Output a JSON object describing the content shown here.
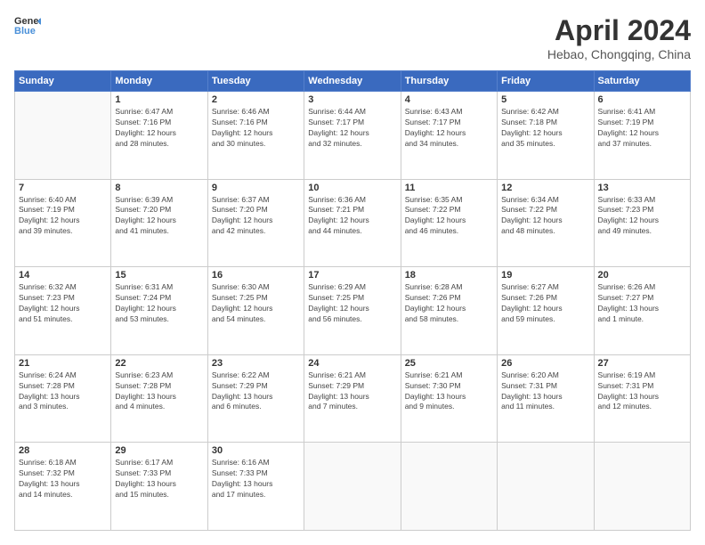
{
  "logo": {
    "line1": "General",
    "line2": "Blue"
  },
  "title": "April 2024",
  "subtitle": "Hebao, Chongqing, China",
  "days_header": [
    "Sunday",
    "Monday",
    "Tuesday",
    "Wednesday",
    "Thursday",
    "Friday",
    "Saturday"
  ],
  "weeks": [
    [
      {
        "num": "",
        "info": ""
      },
      {
        "num": "1",
        "info": "Sunrise: 6:47 AM\nSunset: 7:16 PM\nDaylight: 12 hours\nand 28 minutes."
      },
      {
        "num": "2",
        "info": "Sunrise: 6:46 AM\nSunset: 7:16 PM\nDaylight: 12 hours\nand 30 minutes."
      },
      {
        "num": "3",
        "info": "Sunrise: 6:44 AM\nSunset: 7:17 PM\nDaylight: 12 hours\nand 32 minutes."
      },
      {
        "num": "4",
        "info": "Sunrise: 6:43 AM\nSunset: 7:17 PM\nDaylight: 12 hours\nand 34 minutes."
      },
      {
        "num": "5",
        "info": "Sunrise: 6:42 AM\nSunset: 7:18 PM\nDaylight: 12 hours\nand 35 minutes."
      },
      {
        "num": "6",
        "info": "Sunrise: 6:41 AM\nSunset: 7:19 PM\nDaylight: 12 hours\nand 37 minutes."
      }
    ],
    [
      {
        "num": "7",
        "info": "Sunrise: 6:40 AM\nSunset: 7:19 PM\nDaylight: 12 hours\nand 39 minutes."
      },
      {
        "num": "8",
        "info": "Sunrise: 6:39 AM\nSunset: 7:20 PM\nDaylight: 12 hours\nand 41 minutes."
      },
      {
        "num": "9",
        "info": "Sunrise: 6:37 AM\nSunset: 7:20 PM\nDaylight: 12 hours\nand 42 minutes."
      },
      {
        "num": "10",
        "info": "Sunrise: 6:36 AM\nSunset: 7:21 PM\nDaylight: 12 hours\nand 44 minutes."
      },
      {
        "num": "11",
        "info": "Sunrise: 6:35 AM\nSunset: 7:22 PM\nDaylight: 12 hours\nand 46 minutes."
      },
      {
        "num": "12",
        "info": "Sunrise: 6:34 AM\nSunset: 7:22 PM\nDaylight: 12 hours\nand 48 minutes."
      },
      {
        "num": "13",
        "info": "Sunrise: 6:33 AM\nSunset: 7:23 PM\nDaylight: 12 hours\nand 49 minutes."
      }
    ],
    [
      {
        "num": "14",
        "info": "Sunrise: 6:32 AM\nSunset: 7:23 PM\nDaylight: 12 hours\nand 51 minutes."
      },
      {
        "num": "15",
        "info": "Sunrise: 6:31 AM\nSunset: 7:24 PM\nDaylight: 12 hours\nand 53 minutes."
      },
      {
        "num": "16",
        "info": "Sunrise: 6:30 AM\nSunset: 7:25 PM\nDaylight: 12 hours\nand 54 minutes."
      },
      {
        "num": "17",
        "info": "Sunrise: 6:29 AM\nSunset: 7:25 PM\nDaylight: 12 hours\nand 56 minutes."
      },
      {
        "num": "18",
        "info": "Sunrise: 6:28 AM\nSunset: 7:26 PM\nDaylight: 12 hours\nand 58 minutes."
      },
      {
        "num": "19",
        "info": "Sunrise: 6:27 AM\nSunset: 7:26 PM\nDaylight: 12 hours\nand 59 minutes."
      },
      {
        "num": "20",
        "info": "Sunrise: 6:26 AM\nSunset: 7:27 PM\nDaylight: 13 hours\nand 1 minute."
      }
    ],
    [
      {
        "num": "21",
        "info": "Sunrise: 6:24 AM\nSunset: 7:28 PM\nDaylight: 13 hours\nand 3 minutes."
      },
      {
        "num": "22",
        "info": "Sunrise: 6:23 AM\nSunset: 7:28 PM\nDaylight: 13 hours\nand 4 minutes."
      },
      {
        "num": "23",
        "info": "Sunrise: 6:22 AM\nSunset: 7:29 PM\nDaylight: 13 hours\nand 6 minutes."
      },
      {
        "num": "24",
        "info": "Sunrise: 6:21 AM\nSunset: 7:29 PM\nDaylight: 13 hours\nand 7 minutes."
      },
      {
        "num": "25",
        "info": "Sunrise: 6:21 AM\nSunset: 7:30 PM\nDaylight: 13 hours\nand 9 minutes."
      },
      {
        "num": "26",
        "info": "Sunrise: 6:20 AM\nSunset: 7:31 PM\nDaylight: 13 hours\nand 11 minutes."
      },
      {
        "num": "27",
        "info": "Sunrise: 6:19 AM\nSunset: 7:31 PM\nDaylight: 13 hours\nand 12 minutes."
      }
    ],
    [
      {
        "num": "28",
        "info": "Sunrise: 6:18 AM\nSunset: 7:32 PM\nDaylight: 13 hours\nand 14 minutes."
      },
      {
        "num": "29",
        "info": "Sunrise: 6:17 AM\nSunset: 7:33 PM\nDaylight: 13 hours\nand 15 minutes."
      },
      {
        "num": "30",
        "info": "Sunrise: 6:16 AM\nSunset: 7:33 PM\nDaylight: 13 hours\nand 17 minutes."
      },
      {
        "num": "",
        "info": ""
      },
      {
        "num": "",
        "info": ""
      },
      {
        "num": "",
        "info": ""
      },
      {
        "num": "",
        "info": ""
      }
    ]
  ]
}
